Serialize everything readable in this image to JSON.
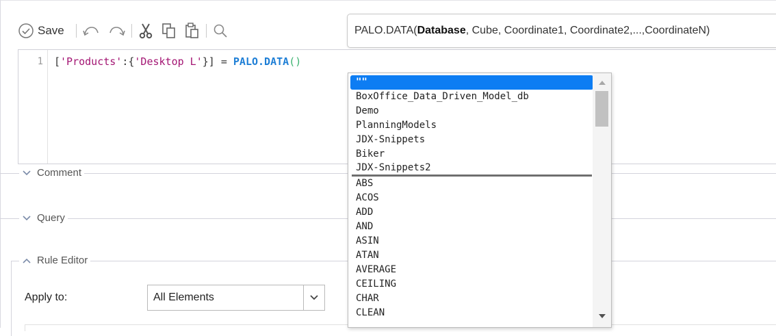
{
  "toolbar": {
    "save_label": "Save",
    "icons": [
      "save-check-icon",
      "undo-icon",
      "redo-icon",
      "cut-icon",
      "copy-icon",
      "paste-icon",
      "search-icon"
    ]
  },
  "signature": {
    "fn": "PALO.DATA(",
    "current_param": "Database",
    "rest": ", Cube, Coordinate1, Coordinate2,...,CoordinateN)"
  },
  "editor": {
    "line_number": "1",
    "code_prefix": "[",
    "code_str1": "'Products'",
    "code_colon": ":{",
    "code_str2": "'Desktop L'",
    "code_mid": "}] = ",
    "code_fn": "PALO.DATA",
    "code_paren": "()"
  },
  "sections": {
    "comment": "Comment",
    "query": "Query",
    "rule_editor": "Rule Editor"
  },
  "rule_editor": {
    "apply_to_label": "Apply to:",
    "apply_to_value": "All Elements"
  },
  "autocomplete": {
    "selected": "\"\"",
    "databases": [
      "BoxOffice_Data_Driven_Model_db",
      "Demo",
      "PlanningModels",
      "JDX-Snippets",
      "Biker",
      "JDX-Snippets2"
    ],
    "functions": [
      "ABS",
      "ACOS",
      "ADD",
      "AND",
      "ASIN",
      "ATAN",
      "AVERAGE",
      "CEILING",
      "CHAR",
      "CLEAN"
    ]
  },
  "colors": {
    "selection": "#0d7df3",
    "function_name": "#1f7fd6",
    "string": "#a31573",
    "paren": "#3cb371"
  }
}
